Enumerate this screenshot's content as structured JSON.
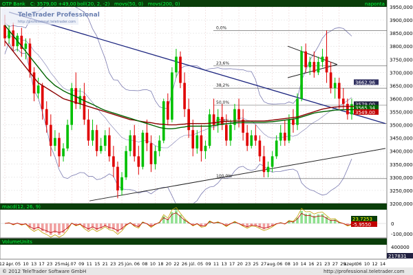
{
  "header": {
    "instrument": "OTP Bank",
    "quote": "C: 3579,00 +49,00",
    "indicators": "boll(20, 2, -2)   movs(50, 0)   movs(200, 0)",
    "period": "napontа",
    "watermark_title": "TeleTrader Professional",
    "watermark_url": "http://professional.teletrader.com"
  },
  "macd_panel": {
    "title": "macd(12, 26, 9)",
    "tick_labels": [
      "0",
      "-100,000"
    ],
    "value_labels": [
      "23,7253",
      "-5,9550"
    ]
  },
  "volume_panel": {
    "title": "VolumeUnits",
    "tick_labels": [
      "400000"
    ],
    "last_value": "217831"
  },
  "footer": {
    "copyright": "© 2012 TeleTrader Software GmbH",
    "url": "http://professional.teletrader.com"
  },
  "colors": {
    "up_candle": "#00c000",
    "down_candle": "#e00000",
    "bollinger": "#7a7ab0",
    "ma50": "#8b0000",
    "ma200": "#006400",
    "trendline": "#1a237e",
    "panel_bg": "#ffffff",
    "header_bg": "#0a3d0a",
    "header_text": "#00ff40",
    "price_label_bg": "#202040"
  },
  "chart_data": {
    "type": "candlestick",
    "ylim": [
      3200,
      3950
    ],
    "yticks": [
      "3950,000",
      "3900,000",
      "3850,000",
      "3800,000",
      "3750,000",
      "3700,000",
      "3650,000",
      "3600,000",
      "3550,000",
      "3500,000",
      "3450,000",
      "3400,000",
      "3350,000",
      "3300,000",
      "3250,000",
      "3200,000"
    ],
    "xlabels": [
      "12",
      "ápr.",
      "05",
      "10",
      "13",
      "17",
      "23",
      "25",
      "máj.",
      "07",
      "09",
      "11",
      "15",
      "21",
      "23",
      "25",
      "jún.",
      "06",
      "08",
      "10",
      "18",
      "20",
      "22",
      "26",
      "júl.",
      "05",
      "09",
      "11",
      "13",
      "17",
      "20",
      "23",
      "25",
      "27",
      "aug.",
      "06",
      "08",
      "10",
      "14",
      "16",
      "21",
      "23",
      "27",
      "29",
      "szept.",
      "06",
      "10",
      "12",
      "14"
    ],
    "price_labels": [
      "3579,00",
      "3565,34",
      "3662,96",
      "3549,00"
    ],
    "fibonacci": [
      {
        "label": "0,0%",
        "value": 3860
      },
      {
        "label": "23,6%",
        "value": 3725
      },
      {
        "label": "38,2%",
        "value": 3640
      },
      {
        "label": "50,0%",
        "value": 3575
      },
      {
        "label": "61,8%",
        "value": 3505
      },
      {
        "label": "100,0%",
        "value": 3295
      }
    ],
    "candles": [
      {
        "o": 3880,
        "h": 3920,
        "c": 3830,
        "l": 3800
      },
      {
        "o": 3830,
        "h": 3880,
        "c": 3860,
        "l": 3810
      },
      {
        "o": 3860,
        "h": 3890,
        "c": 3800,
        "l": 3780
      },
      {
        "o": 3800,
        "h": 3850,
        "c": 3840,
        "l": 3780
      },
      {
        "o": 3840,
        "h": 3870,
        "c": 3790,
        "l": 3760
      },
      {
        "o": 3790,
        "h": 3830,
        "c": 3810,
        "l": 3750
      },
      {
        "o": 3810,
        "h": 3830,
        "c": 3700,
        "l": 3680
      },
      {
        "o": 3700,
        "h": 3720,
        "c": 3620,
        "l": 3590
      },
      {
        "o": 3620,
        "h": 3680,
        "c": 3650,
        "l": 3600
      },
      {
        "o": 3650,
        "h": 3660,
        "c": 3560,
        "l": 3520
      },
      {
        "o": 3560,
        "h": 3590,
        "c": 3500,
        "l": 3470
      },
      {
        "o": 3500,
        "h": 3540,
        "c": 3420,
        "l": 3380
      },
      {
        "o": 3420,
        "h": 3480,
        "c": 3450,
        "l": 3400
      },
      {
        "o": 3450,
        "h": 3470,
        "c": 3380,
        "l": 3340
      },
      {
        "o": 3380,
        "h": 3430,
        "c": 3410,
        "l": 3360
      },
      {
        "o": 3410,
        "h": 3520,
        "c": 3500,
        "l": 3400
      },
      {
        "o": 3500,
        "h": 3660,
        "c": 3640,
        "l": 3480
      },
      {
        "o": 3640,
        "h": 3700,
        "c": 3580,
        "l": 3560
      },
      {
        "o": 3580,
        "h": 3640,
        "c": 3610,
        "l": 3560
      },
      {
        "o": 3610,
        "h": 3660,
        "c": 3520,
        "l": 3500
      },
      {
        "o": 3520,
        "h": 3560,
        "c": 3440,
        "l": 3420
      },
      {
        "o": 3440,
        "h": 3520,
        "c": 3480,
        "l": 3420
      },
      {
        "o": 3480,
        "h": 3500,
        "c": 3400,
        "l": 3380
      },
      {
        "o": 3400,
        "h": 3450,
        "c": 3420,
        "l": 3390
      },
      {
        "o": 3420,
        "h": 3480,
        "c": 3460,
        "l": 3400
      },
      {
        "o": 3460,
        "h": 3490,
        "c": 3380,
        "l": 3360
      },
      {
        "o": 3380,
        "h": 3420,
        "c": 3340,
        "l": 3300
      },
      {
        "o": 3340,
        "h": 3360,
        "c": 3250,
        "l": 3220
      },
      {
        "o": 3250,
        "h": 3320,
        "c": 3300,
        "l": 3230
      },
      {
        "o": 3300,
        "h": 3420,
        "c": 3400,
        "l": 3290
      },
      {
        "o": 3400,
        "h": 3480,
        "c": 3460,
        "l": 3380
      },
      {
        "o": 3460,
        "h": 3500,
        "c": 3380,
        "l": 3360
      },
      {
        "o": 3380,
        "h": 3420,
        "c": 3340,
        "l": 3310
      },
      {
        "o": 3340,
        "h": 3480,
        "c": 3470,
        "l": 3330
      },
      {
        "o": 3470,
        "h": 3520,
        "c": 3430,
        "l": 3400
      },
      {
        "o": 3430,
        "h": 3460,
        "c": 3350,
        "l": 3320
      },
      {
        "o": 3350,
        "h": 3420,
        "c": 3400,
        "l": 3330
      },
      {
        "o": 3400,
        "h": 3460,
        "c": 3440,
        "l": 3380
      },
      {
        "o": 3440,
        "h": 3600,
        "c": 3590,
        "l": 3430
      },
      {
        "o": 3590,
        "h": 3620,
        "c": 3520,
        "l": 3500
      },
      {
        "o": 3520,
        "h": 3720,
        "c": 3700,
        "l": 3510
      },
      {
        "o": 3700,
        "h": 3790,
        "c": 3760,
        "l": 3680
      },
      {
        "o": 3760,
        "h": 3780,
        "c": 3660,
        "l": 3640
      },
      {
        "o": 3660,
        "h": 3700,
        "c": 3560,
        "l": 3530
      },
      {
        "o": 3560,
        "h": 3600,
        "c": 3480,
        "l": 3450
      },
      {
        "o": 3480,
        "h": 3520,
        "c": 3410,
        "l": 3380
      },
      {
        "o": 3410,
        "h": 3480,
        "c": 3460,
        "l": 3390
      },
      {
        "o": 3460,
        "h": 3500,
        "c": 3400,
        "l": 3360
      },
      {
        "o": 3400,
        "h": 3440,
        "c": 3420,
        "l": 3370
      },
      {
        "o": 3420,
        "h": 3560,
        "c": 3540,
        "l": 3410
      },
      {
        "o": 3540,
        "h": 3600,
        "c": 3500,
        "l": 3480
      },
      {
        "o": 3500,
        "h": 3560,
        "c": 3530,
        "l": 3470
      },
      {
        "o": 3530,
        "h": 3580,
        "c": 3500,
        "l": 3480
      },
      {
        "o": 3500,
        "h": 3540,
        "c": 3440,
        "l": 3420
      },
      {
        "o": 3440,
        "h": 3520,
        "c": 3500,
        "l": 3420
      },
      {
        "o": 3500,
        "h": 3580,
        "c": 3560,
        "l": 3480
      },
      {
        "o": 3560,
        "h": 3600,
        "c": 3520,
        "l": 3490
      },
      {
        "o": 3520,
        "h": 3560,
        "c": 3470,
        "l": 3440
      },
      {
        "o": 3470,
        "h": 3500,
        "c": 3420,
        "l": 3400
      },
      {
        "o": 3420,
        "h": 3480,
        "c": 3460,
        "l": 3410
      },
      {
        "o": 3460,
        "h": 3500,
        "c": 3440,
        "l": 3420
      },
      {
        "o": 3440,
        "h": 3460,
        "c": 3380,
        "l": 3360
      },
      {
        "o": 3380,
        "h": 3420,
        "c": 3320,
        "l": 3300
      },
      {
        "o": 3320,
        "h": 3360,
        "c": 3340,
        "l": 3300
      },
      {
        "o": 3340,
        "h": 3400,
        "c": 3380,
        "l": 3320
      },
      {
        "o": 3380,
        "h": 3460,
        "c": 3440,
        "l": 3370
      },
      {
        "o": 3440,
        "h": 3500,
        "c": 3470,
        "l": 3420
      },
      {
        "o": 3470,
        "h": 3520,
        "c": 3440,
        "l": 3420
      },
      {
        "o": 3440,
        "h": 3540,
        "c": 3520,
        "l": 3430
      },
      {
        "o": 3520,
        "h": 3560,
        "c": 3500,
        "l": 3470
      },
      {
        "o": 3500,
        "h": 3620,
        "c": 3600,
        "l": 3480
      },
      {
        "o": 3600,
        "h": 3800,
        "c": 3780,
        "l": 3590
      },
      {
        "o": 3780,
        "h": 3810,
        "c": 3720,
        "l": 3700
      },
      {
        "o": 3720,
        "h": 3760,
        "c": 3740,
        "l": 3690
      },
      {
        "o": 3740,
        "h": 3780,
        "c": 3700,
        "l": 3680
      },
      {
        "o": 3700,
        "h": 3760,
        "c": 3740,
        "l": 3690
      },
      {
        "o": 3740,
        "h": 3790,
        "c": 3760,
        "l": 3720
      },
      {
        "o": 3760,
        "h": 3860,
        "c": 3700,
        "l": 3660
      },
      {
        "o": 3700,
        "h": 3740,
        "c": 3640,
        "l": 3620
      },
      {
        "o": 3640,
        "h": 3680,
        "c": 3660,
        "l": 3600
      },
      {
        "o": 3660,
        "h": 3680,
        "c": 3600,
        "l": 3560
      },
      {
        "o": 3600,
        "h": 3640,
        "c": 3580,
        "l": 3560
      },
      {
        "o": 3580,
        "h": 3600,
        "c": 3540,
        "l": 3520
      },
      {
        "o": 3540,
        "h": 3600,
        "c": 3579,
        "l": 3520
      }
    ],
    "ma50": [
      3820,
      3800,
      3780,
      3760,
      3740,
      3720,
      3700,
      3680,
      3660,
      3650,
      3640,
      3630,
      3620,
      3610,
      3600,
      3595,
      3590,
      3585,
      3580,
      3575,
      3570,
      3565,
      3560,
      3555,
      3550,
      3545,
      3540,
      3535,
      3530,
      3525,
      3520,
      3518,
      3515,
      3512,
      3510,
      3508,
      3505,
      3503,
      3502,
      3500,
      3500,
      3500,
      3502,
      3503,
      3505,
      3505,
      3505,
      3505,
      3505,
      3506,
      3508,
      3510,
      3512,
      3513,
      3514,
      3515,
      3515,
      3515,
      3515,
      3515,
      3515,
      3515,
      3515,
      3516,
      3518,
      3520,
      3522,
      3524,
      3526,
      3528,
      3530,
      3535,
      3540,
      3545,
      3550,
      3555,
      3560,
      3563,
      3566,
      3568,
      3569,
      3570,
      3570,
      3570,
      3570
    ],
    "ma200": [
      3880,
      3860,
      3840,
      3820,
      3800,
      3780,
      3760,
      3740,
      3720,
      3700,
      3680,
      3665,
      3650,
      3640,
      3630,
      3622,
      3615,
      3608,
      3600,
      3592,
      3585,
      3578,
      3570,
      3562,
      3555,
      3550,
      3545,
      3540,
      3535,
      3530,
      3525,
      3520,
      3515,
      3510,
      3505,
      3500,
      3495,
      3490,
      3487,
      3485,
      3485,
      3487,
      3490,
      3492,
      3495,
      3495,
      3495,
      3495,
      3495,
      3495,
      3497,
      3500,
      3502,
      3504,
      3506,
      3508,
      3510,
      3510,
      3510,
      3510,
      3510,
      3510,
      3510,
      3511,
      3512,
      3514,
      3516,
      3518,
      3520,
      3522,
      3525,
      3530,
      3535,
      3540,
      3545,
      3548,
      3550,
      3552,
      3554,
      3556,
      3557,
      3558,
      3558,
      3558,
      3558
    ]
  }
}
